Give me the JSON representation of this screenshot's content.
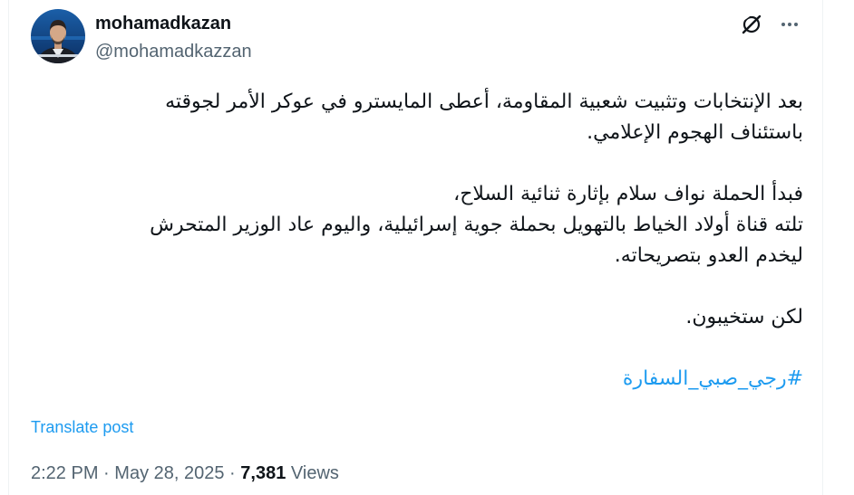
{
  "author": {
    "display_name": "mohamadkazan",
    "handle": "@mohamadkazzan"
  },
  "header_icons": {
    "grok": "grok-icon",
    "more": "more-icon"
  },
  "tweet": {
    "lines": [
      "بعد الإنتخابات وتثبيت شعبية المقاومة، أعطى المايسترو في عوكر الأمر لجوقته",
      "باستئناف الهجوم الإعلامي.",
      "فبدأ الحملة نواف سلام بإثارة ثنائية السلاح،",
      "تلته قناة أولاد الخياط بالتهويل بحملة جوية إسرائيلية، واليوم عاد الوزير المتحرش",
      "ليخدم العدو بتصريحاته.",
      "لكن ستخيبون."
    ],
    "hashtag": "#رجي_صبي_السفارة"
  },
  "translate_label": "Translate post",
  "meta": {
    "time": "2:22 PM",
    "separator": "·",
    "date": "May 28, 2025",
    "views_count": "7,381",
    "views_label": "Views"
  },
  "colors": {
    "accent": "#1d9bf0",
    "secondary_text": "#536471",
    "primary_text": "#0f1419"
  }
}
